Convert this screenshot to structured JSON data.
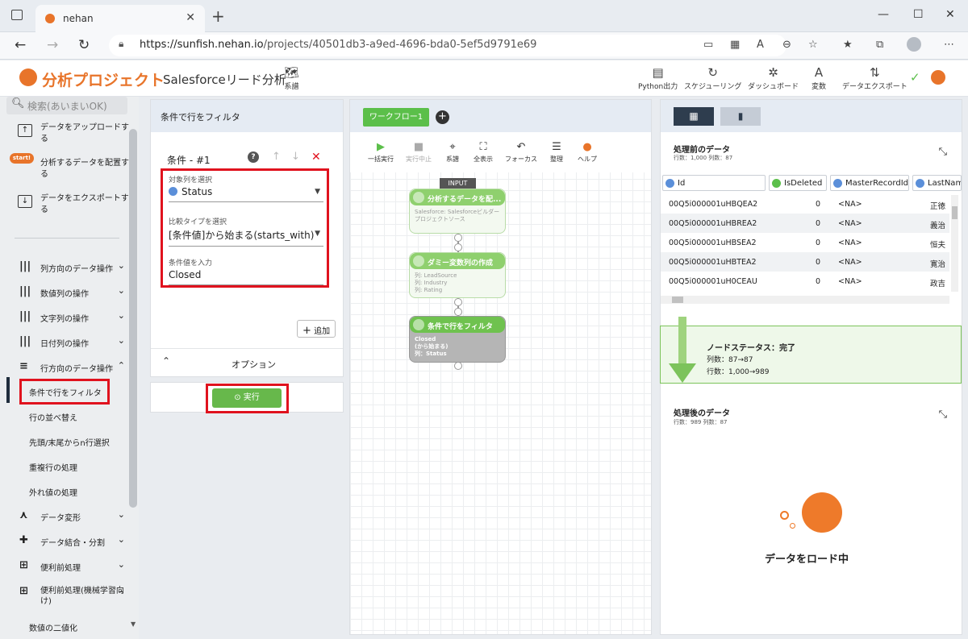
{
  "browser": {
    "tab_title": "nehan",
    "url_host": "https://sunfish.nehan.io",
    "url_path": "/projects/40501db3-a9ed-4696-bda0-5ef5d9791e69"
  },
  "header": {
    "logo": "分析プロジェクト",
    "project_title": "Salesforceリード分析",
    "lineage_label": "系譜",
    "buttons": [
      "Python出力",
      "スケジューリング",
      "ダッシュボード",
      "変数",
      "データエクスポート"
    ]
  },
  "sidebar": {
    "search_placeholder": "検索(あいまいOK)",
    "top_items": [
      "データをアップロードする",
      "分析するデータを配置する",
      "データをエクスポートする"
    ],
    "start_badge": "start!",
    "categories": [
      "列方向のデータ操作",
      "数値列の操作",
      "文字列の操作",
      "日付列の操作",
      "行方向のデータ操作"
    ],
    "sub_items": [
      "条件で行をフィルタ",
      "行の並べ替え",
      "先頭/末尾からn行選択",
      "重複行の処理",
      "外れ値の処理"
    ],
    "lower_categories": [
      "データ変形",
      "データ結合・分割",
      "便利前処理",
      "便利前処理(機械学習向け)"
    ],
    "last_item": "数値の二値化"
  },
  "filter_panel": {
    "title": "条件で行をフィルタ",
    "condition_title": "条件 - #1",
    "target_label": "対象列を選択",
    "target_value": "Status",
    "compare_label": "比較タイプを選択",
    "compare_value": "[条件値]から始まる(starts_with)",
    "value_label": "条件値を入力",
    "value_value": "Closed",
    "add_label": "追加",
    "options_label": "オプション",
    "run_label": "実行"
  },
  "workflow": {
    "tab_label": "ワークフロー1",
    "toolbar": [
      "一括実行",
      "実行中止",
      "系譜",
      "全表示",
      "フォーカス",
      "整理",
      "ヘルプ"
    ],
    "input_tag": "INPUT",
    "nodes": [
      {
        "title": "分析するデータを配...",
        "body": "Salesforce: Salesforceビルダープロジェクトソース"
      },
      {
        "title": "ダミー変数列の作成",
        "body": "列: LeadSource\n列: Industry\n列: Rating"
      },
      {
        "title": "条件で行をフィルタ",
        "body": "Closed\n(から始まる)\n列：Status"
      }
    ]
  },
  "right_panel": {
    "before_title": "処理前のデータ",
    "before_sub": "行数：1,000 列数：87",
    "columns": [
      "Id",
      "IsDeleted",
      "MasterRecordId",
      "LastName"
    ],
    "rows": [
      [
        "00Q5i000001uHBQEA2",
        "0",
        "<NA>",
        "正徳"
      ],
      [
        "00Q5i000001uHBREA2",
        "0",
        "<NA>",
        "義治"
      ],
      [
        "00Q5i000001uHBSEA2",
        "0",
        "<NA>",
        "恒夫"
      ],
      [
        "00Q5i000001uHBTEA2",
        "0",
        "<NA>",
        "寛治"
      ],
      [
        "00Q5i000001uH0CEAU",
        "0",
        "<NA>",
        "政吉"
      ]
    ],
    "status_title": "ノードステータス：完了",
    "status_cols": "列数：87→87",
    "status_rows": "行数：1,000→989",
    "after_title": "処理後のデータ",
    "after_sub": "行数：989 列数：87",
    "loading": "データをロード中"
  },
  "colors": {
    "accent": "#e8742a",
    "green": "#67b84b",
    "highlight": "#e0121e"
  }
}
